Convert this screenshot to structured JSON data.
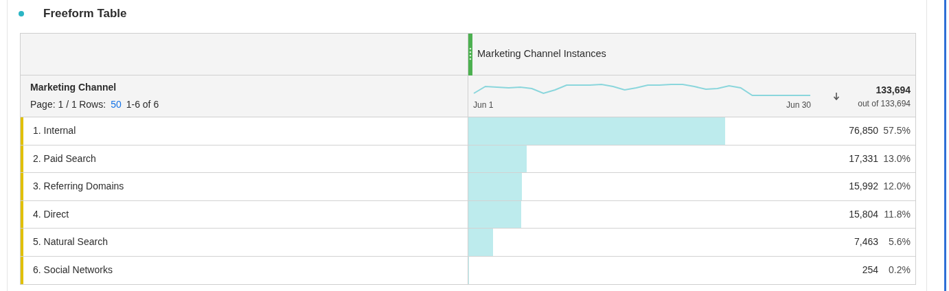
{
  "panel": {
    "title": "Freeform Table"
  },
  "table": {
    "dimension": "Marketing Channel",
    "pagination": {
      "page_label": "Page:",
      "page": "1 / 1",
      "rows_label": "Rows:",
      "rows": "50",
      "range": "1-6 of 6"
    },
    "metric": {
      "name": "Marketing Channel Instances",
      "sparkline_start": "Jun 1",
      "sparkline_end": "Jun 30",
      "total": "133,694",
      "total_of": "out of 133,694"
    },
    "rows": [
      {
        "rank": "1.",
        "name": "Internal",
        "value": "76,850",
        "percent": "57.5%",
        "level": 0.575
      },
      {
        "rank": "2.",
        "name": "Paid Search",
        "value": "17,331",
        "percent": "13.0%",
        "level": 0.13
      },
      {
        "rank": "3.",
        "name": "Referring Domains",
        "value": "15,992",
        "percent": "12.0%",
        "level": 0.12
      },
      {
        "rank": "4.",
        "name": "Direct",
        "value": "15,804",
        "percent": "11.8%",
        "level": 0.118
      },
      {
        "rank": "5.",
        "name": "Natural Search",
        "value": "7,463",
        "percent": "5.6%",
        "level": 0.056
      },
      {
        "rank": "6.",
        "name": "Social Networks",
        "value": "254",
        "percent": "0.2%",
        "level": 0.002
      }
    ]
  }
}
